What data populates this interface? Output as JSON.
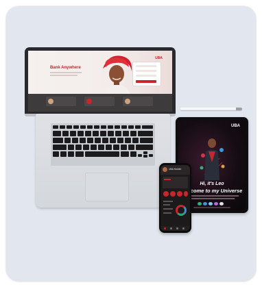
{
  "laptop": {
    "hero_title": "Bank Anywhere",
    "logo": "UBA"
  },
  "tablet": {
    "logo": "UBA",
    "headline_1": "Hi, it's Leo",
    "headline_2": "Welcome to my Universe"
  },
  "phone": {
    "app_title": "UBA Mobile"
  },
  "colors": {
    "brand_red": "#c9252c",
    "card_bg": "#e2e6ef"
  }
}
